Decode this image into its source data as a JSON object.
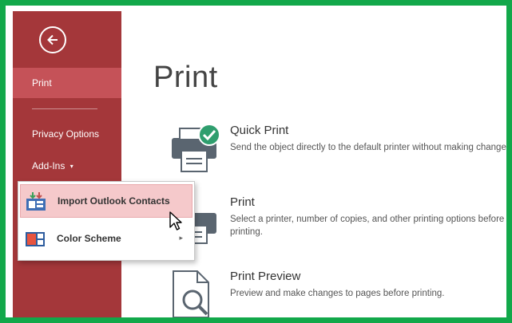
{
  "sidebar": {
    "items": [
      {
        "label": "Print"
      },
      {
        "label": "Privacy Options"
      },
      {
        "label": "Add-Ins"
      }
    ],
    "addins_caret": "▾"
  },
  "main": {
    "title": "Print",
    "options": [
      {
        "title": "Quick Print",
        "description": "Send the object directly to the default printer without making changes."
      },
      {
        "title": "Print",
        "description": "Select a printer, number of copies, and other printing options before printing."
      },
      {
        "title": "Print Preview",
        "description": "Preview and make changes to pages before printing."
      }
    ]
  },
  "addins_menu": {
    "items": [
      {
        "label": "Import Outlook Contacts",
        "icon": "contacts-import-icon"
      },
      {
        "label": "Color Scheme",
        "icon": "color-scheme-icon",
        "submenu_arrow": "▸"
      }
    ]
  },
  "colors": {
    "sidebar": "#a4373a",
    "sidebar_selected": "#c55258",
    "frame_border": "#12a84a",
    "menu_highlight": "#f5c9cb"
  }
}
